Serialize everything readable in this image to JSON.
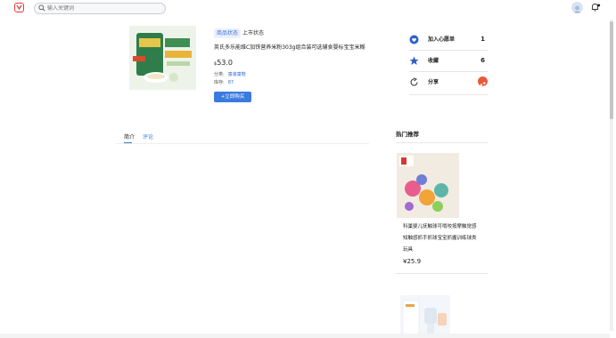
{
  "header": {
    "search_placeholder": "输入关键词"
  },
  "product": {
    "tag_status": "商品状态",
    "tag_listing": "上市状态",
    "title": "英氏多乐能维C加铁营养米粉303g组合装可选辅食婴标宝宝米糊",
    "price_symbol": "$",
    "price_value": "53.0",
    "category_label": "分类:",
    "category_value": "童装童鞋",
    "stock_label": "库存:",
    "stock_value": "87",
    "buy_button": "+立即购买"
  },
  "side_actions": [
    {
      "label": "加入心愿单",
      "count": "1",
      "icon": "heart-add-icon"
    },
    {
      "label": "收藏",
      "count": "6",
      "icon": "star-icon"
    },
    {
      "label": "分享",
      "icon": "share-icon"
    }
  ],
  "tabs": {
    "intro": "简介",
    "review": "评论"
  },
  "recommend": {
    "title": "热门推荐",
    "item1_name": "科巢婴儿抚触球可啃咬按摩触觉感知触感抓手抓球宝宝抓握训练球类玩具",
    "item1_price": "¥25.9"
  },
  "colors": {
    "accent": "#3a7be0",
    "logo": "#e23b3b",
    "share_badge": "#e65a3a"
  }
}
